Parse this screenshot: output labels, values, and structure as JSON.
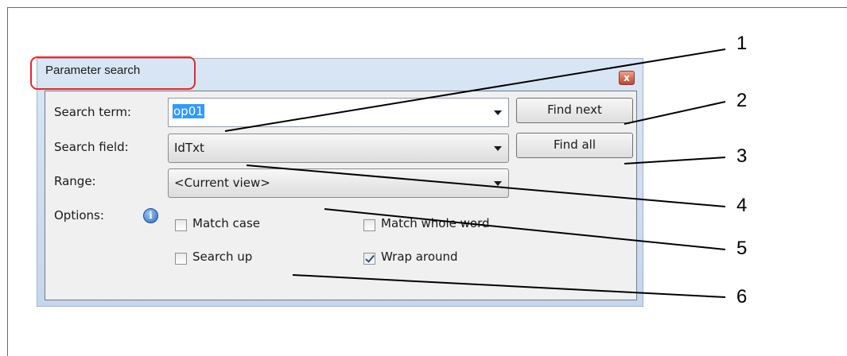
{
  "dialog": {
    "title": "Parameter search",
    "close_glyph": "x",
    "labels": {
      "search_term": "Search term:",
      "search_field": "Search field:",
      "range": "Range:",
      "options": "Options:"
    },
    "search_term": {
      "value": "op01"
    },
    "search_field": {
      "value": "IdTxt"
    },
    "range": {
      "value": "<Current view>"
    },
    "buttons": {
      "find_next": "Find next",
      "find_all": "Find all"
    },
    "info_glyph": "i",
    "options": {
      "match_case": {
        "label": "Match case",
        "checked": false
      },
      "match_whole_word": {
        "label": "Match whole word",
        "checked": false
      },
      "search_up": {
        "label": "Search up",
        "checked": false
      },
      "wrap_around": {
        "label": "Wrap around",
        "checked": true
      }
    }
  },
  "callouts": [
    "1",
    "2",
    "3",
    "4",
    "5",
    "6"
  ],
  "colors": {
    "title_highlight": "#e8262d",
    "selection": "#3399ff",
    "client_background": "#f0f0f0"
  }
}
